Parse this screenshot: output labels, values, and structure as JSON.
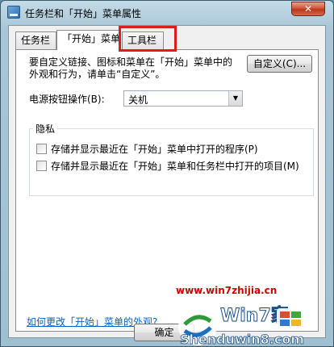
{
  "window": {
    "title": "任务栏和「开始」菜单属性",
    "close_glyph": "✕",
    "icon": "taskbar-properties-icon"
  },
  "tabs": [
    {
      "label": "任务栏",
      "active": false
    },
    {
      "label": "「开始」菜单",
      "active": true
    },
    {
      "label": "工具栏",
      "active": false,
      "highlighted": true
    }
  ],
  "start_menu": {
    "description": "要自定义链接、图标和菜单在「开始」菜单中的外观和行为，请单击“自定义”。",
    "customize_label": "自定义(C)...",
    "power_label": "电源按钮操作(B):",
    "power_value": "关机",
    "privacy": {
      "title": "隐私",
      "items": [
        {
          "label": "存储并显示最近在「开始」菜单中打开的程序(P)",
          "checked": false
        },
        {
          "label": "存储并显示最近在「开始」菜单和任务栏中打开的项目(M)",
          "checked": false
        }
      ]
    },
    "help_link": "如何更改「开始」菜单的外观?"
  },
  "footer": {
    "ok_label": "确定"
  },
  "watermark": {
    "url_top": "www.win7zhijia.cn",
    "brand": "Win7家",
    "url_bottom": "Shenduwin8.com",
    "text_color": "#d10000"
  },
  "colors": {
    "highlight_box": "#e21a1a",
    "link": "#0066cc"
  }
}
